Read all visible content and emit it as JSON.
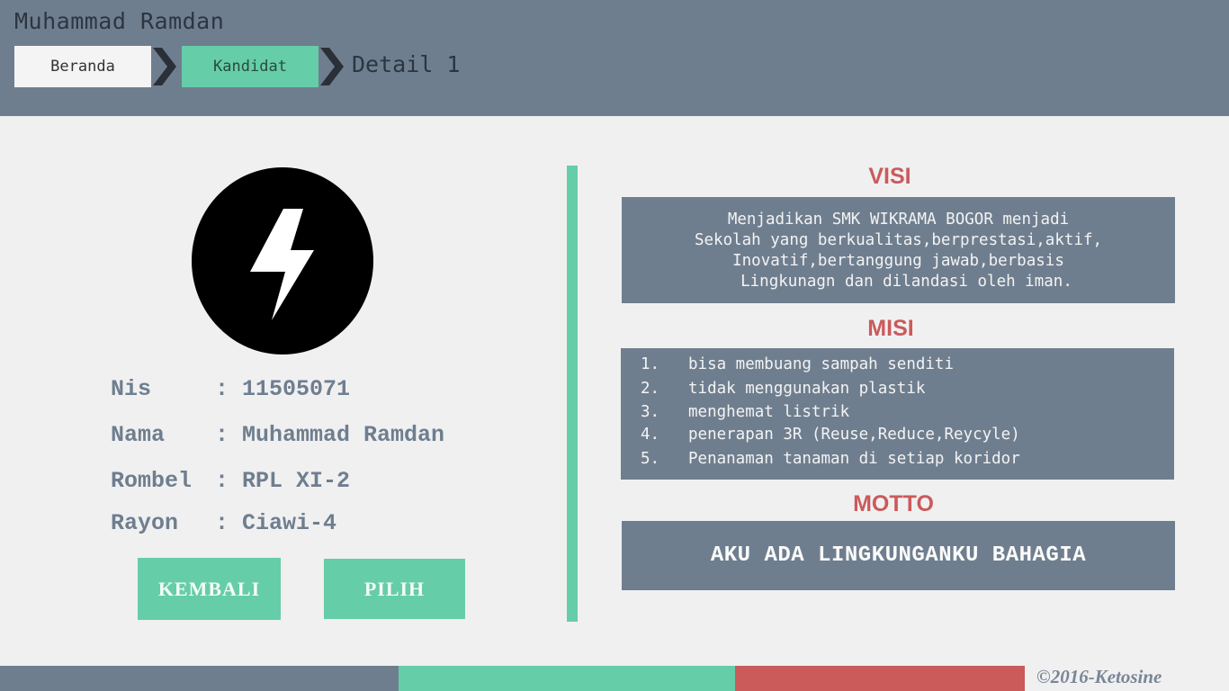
{
  "header": {
    "title": "Muhammad Ramdan",
    "breadcrumb": {
      "home": "Beranda",
      "candidates": "Kandidat",
      "current": "Detail 1"
    }
  },
  "profile": {
    "avatar_icon": "lightning-bolt-icon",
    "fields": [
      {
        "label": "Nis",
        "sep": ":",
        "value": "11505071"
      },
      {
        "label": "Nama",
        "sep": ":",
        "value": "Muhammad Ramdan"
      },
      {
        "label": "Rombel",
        "sep": ":",
        "value": "RPL XI-2"
      },
      {
        "label": "Rayon",
        "sep": ":",
        "value": "Ciawi-4"
      }
    ],
    "buttons": {
      "back": "KEMBALI",
      "select": "PILIH"
    }
  },
  "visi": {
    "title": "VISI",
    "lines": [
      "Menjadikan SMK WIKRAMA BOGOR menjadi",
      "Sekolah yang berkualitas,berprestasi,aktif,",
      "Inovatif,bertanggung jawab,berbasis",
      "Lingkunagn dan dilandasi oleh iman."
    ]
  },
  "misi": {
    "title": "MISI",
    "items": [
      {
        "num": "1.",
        "text": "bisa membuang sampah senditi"
      },
      {
        "num": "2.",
        "text": "tidak menggunakan plastik"
      },
      {
        "num": "3.",
        "text": "menghemat listrik"
      },
      {
        "num": "4.",
        "text": "penerapan 3R (Reuse,Reduce,Reycyle)"
      },
      {
        "num": "5.",
        "text": "Penanaman tanaman di setiap koridor"
      }
    ]
  },
  "motto": {
    "title": "MOTTO",
    "text": "AKU ADA LINGKUNGANKU BAHAGIA"
  },
  "footer": {
    "copyright": "©2016-Ketosine"
  },
  "colors": {
    "slate": "#6f7e8f",
    "green": "#66cda9",
    "red": "#cb5a5a",
    "background": "#f0f0f1"
  }
}
